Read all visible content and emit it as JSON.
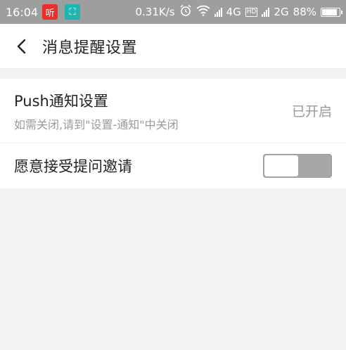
{
  "status_bar": {
    "time": "16:04",
    "app_badge_1": "听",
    "app_badge_2": "⛶",
    "net_speed": "0.31K/s",
    "network_1": "4G",
    "hd": "HD",
    "network_2": "2G",
    "battery_percent": "88%",
    "battery_level": 0.88
  },
  "header": {
    "title": "消息提醒设置"
  },
  "settings": {
    "push": {
      "title": "Push通知设置",
      "subtitle": "如需关闭,请到\"设置-通知\"中关闭",
      "value": "已开启"
    },
    "invite": {
      "title": "愿意接受提问邀请",
      "enabled": false
    }
  },
  "colors": {
    "status_bar": "#9e9e9e",
    "badge_red": "#e8312b",
    "badge_teal": "#22b5b0",
    "toggle_off": "#a7a7a7"
  }
}
